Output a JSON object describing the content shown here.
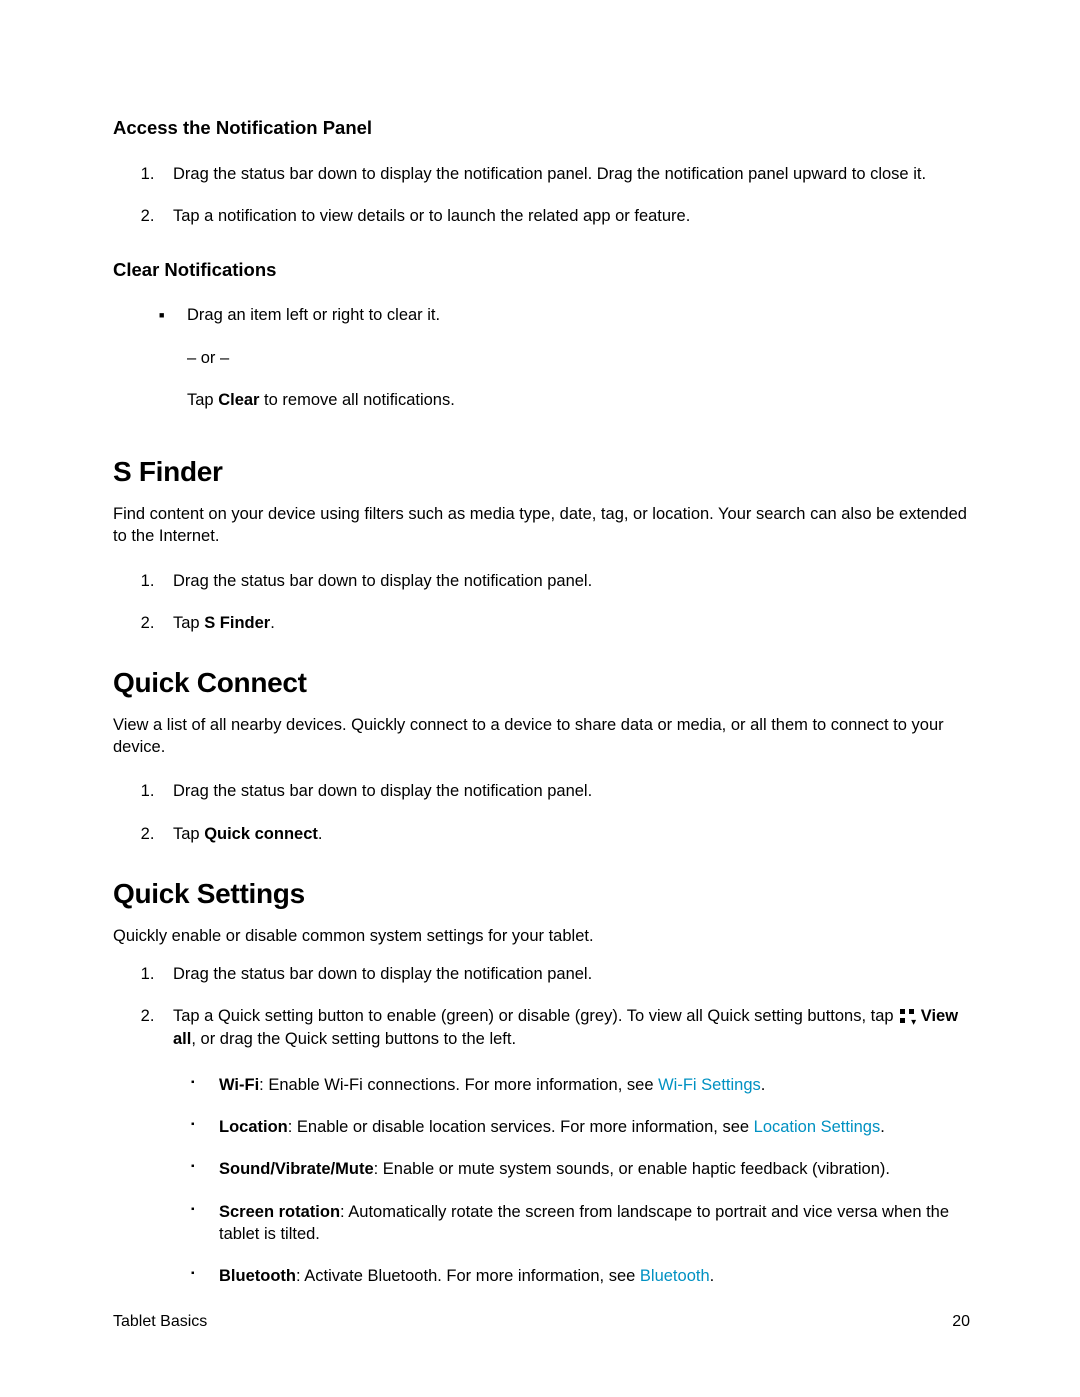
{
  "access": {
    "heading": "Access the Notification Panel",
    "steps": [
      "Drag the status bar down to display the notification panel. Drag the notification panel upward to close it.",
      "Tap a notification to view details or to launch the related app or feature."
    ]
  },
  "clear": {
    "heading": "Clear Notifications",
    "bullets": [
      {
        "line1": "Drag an item left or right to clear it.",
        "or": "– or –",
        "tap_prefix": "Tap ",
        "tap_bold": "Clear",
        "tap_suffix": " to remove all notifications."
      }
    ]
  },
  "sfinder": {
    "heading": "S Finder",
    "body": "Find content on your device using filters such as media type, date, tag, or location. Your search can also be extended to the Internet.",
    "steps": [
      {
        "text": "Drag the status bar down to display the notification panel."
      },
      {
        "prefix": "Tap ",
        "bold": "S Finder",
        "suffix": "."
      }
    ]
  },
  "qconnect": {
    "heading": "Quick Connect",
    "body": "View a list of all nearby devices. Quickly connect to a device to share data or media, or all them to connect to your device.",
    "steps": [
      {
        "text": "Drag the status bar down to display the notification panel."
      },
      {
        "prefix": "Tap ",
        "bold": "Quick connect",
        "suffix": "."
      }
    ]
  },
  "qsettings": {
    "heading": "Quick Settings",
    "body": "Quickly enable or disable common system settings for your tablet.",
    "step1": "Drag the status bar down to display the notification panel.",
    "step2_pre": "Tap a Quick setting button to enable (green) or disable (grey). To view all Quick setting buttons, tap ",
    "step2_icon_name": "view-all-grid-icon",
    "step2_bold": " View all",
    "step2_post": ", or drag the Quick setting buttons to the left.",
    "items": [
      {
        "bold": "Wi-Fi",
        "text": ": Enable Wi-Fi connections. For more information, see ",
        "link": "Wi-Fi Settings",
        "after": "."
      },
      {
        "bold": "Location",
        "text": ": Enable or disable location services. For more information, see ",
        "link": "Location Settings",
        "after": "."
      },
      {
        "bold": "Sound/Vibrate/Mute",
        "text": ": Enable or mute system sounds, or enable haptic feedback (vibration).",
        "link": "",
        "after": ""
      },
      {
        "bold": "Screen rotation",
        "text": ": Automatically rotate the screen from landscape to portrait and vice versa when the tablet is tilted.",
        "link": "",
        "after": ""
      },
      {
        "bold": "Bluetooth",
        "text": ": Activate Bluetooth. For more information, see ",
        "link": "Bluetooth",
        "after": "."
      }
    ]
  },
  "footer": {
    "left": "Tablet Basics",
    "right": "20"
  }
}
